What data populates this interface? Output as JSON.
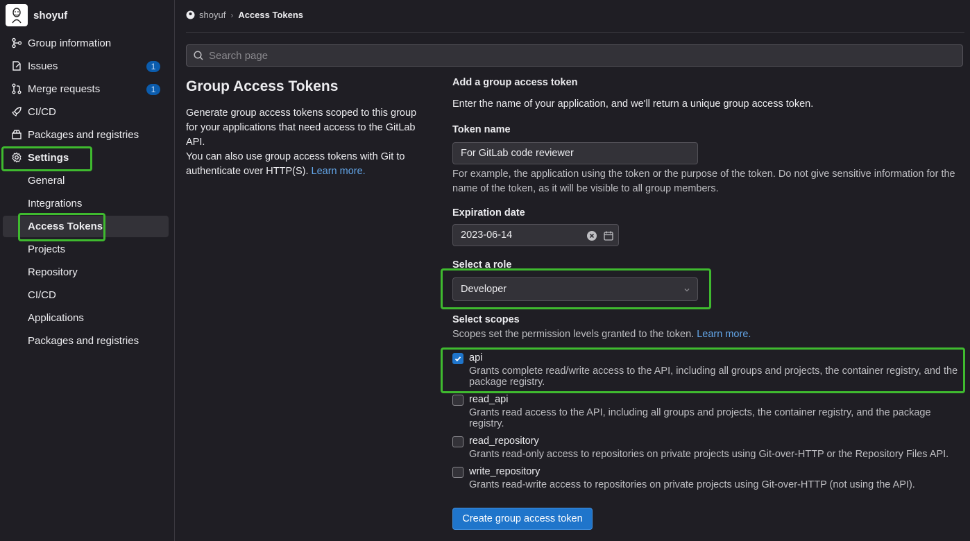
{
  "group": {
    "name": "shoyuf"
  },
  "sidebar": {
    "items": [
      {
        "label": "Group information"
      },
      {
        "label": "Issues",
        "badge": "1"
      },
      {
        "label": "Merge requests",
        "badge": "1"
      },
      {
        "label": "CI/CD"
      },
      {
        "label": "Packages and registries"
      },
      {
        "label": "Settings"
      }
    ],
    "settings_sub": [
      {
        "label": "General"
      },
      {
        "label": "Integrations"
      },
      {
        "label": "Access Tokens"
      },
      {
        "label": "Projects"
      },
      {
        "label": "Repository"
      },
      {
        "label": "CI/CD"
      },
      {
        "label": "Applications"
      },
      {
        "label": "Packages and registries"
      }
    ]
  },
  "breadcrumb": {
    "group": "shoyuf",
    "current": "Access Tokens"
  },
  "search": {
    "placeholder": "Search page"
  },
  "intro": {
    "title": "Group Access Tokens",
    "p1": "Generate group access tokens scoped to this group for your applications that need access to the GitLab API.",
    "p2": "You can also use group access tokens with Git to authenticate over HTTP(S).",
    "learn_more": "Learn more."
  },
  "form": {
    "heading": "Add a group access token",
    "subheading": "Enter the name of your application, and we'll return a unique group access token.",
    "token_name_label": "Token name",
    "token_name_value": "For GitLab code reviewer",
    "token_name_help": "For example, the application using the token or the purpose of the token. Do not give sensitive information for the name of the token, as it will be visible to all group members.",
    "expiration_label": "Expiration date",
    "expiration_value": "2023-06-14",
    "role_label": "Select a role",
    "role_value": "Developer",
    "scopes_label": "Select scopes",
    "scopes_help": "Scopes set the permission levels granted to the token.",
    "scopes_learn_more": "Learn more.",
    "scopes": [
      {
        "name": "api",
        "checked": true,
        "desc": "Grants complete read/write access to the API, including all groups and projects, the container registry, and the package registry."
      },
      {
        "name": "read_api",
        "checked": false,
        "desc": "Grants read access to the API, including all groups and projects, the container registry, and the package registry."
      },
      {
        "name": "read_repository",
        "checked": false,
        "desc": "Grants read-only access to repositories on private projects using Git-over-HTTP or the Repository Files API."
      },
      {
        "name": "write_repository",
        "checked": false,
        "desc": "Grants read-write access to repositories on private projects using Git-over-HTTP (not using the API)."
      }
    ],
    "submit_label": "Create group access token"
  },
  "colors": {
    "highlight": "#3fba2f",
    "link": "#63a6e9",
    "primary_button": "#1f75cb",
    "badge": "#0b5cad"
  }
}
